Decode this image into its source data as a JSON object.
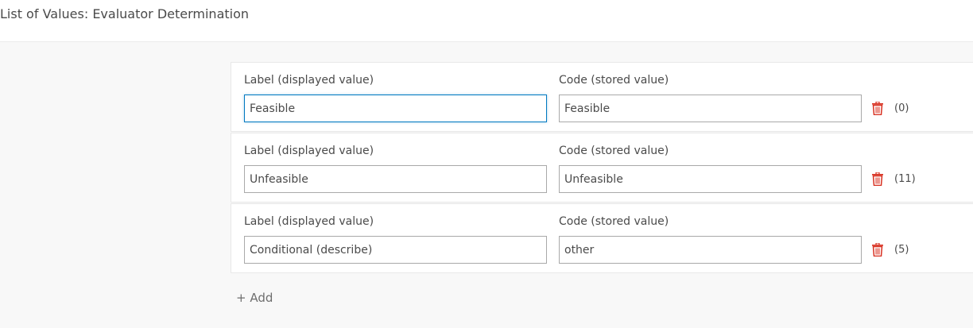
{
  "title": "List of Values: Evaluator Determination",
  "label_header": "Label (displayed value)",
  "code_header": "Code (stored value)",
  "rows": [
    {
      "label": "Feasible",
      "code": "Feasible",
      "count": "(0)"
    },
    {
      "label": "Unfeasible",
      "code": "Unfeasible",
      "count": "(11)"
    },
    {
      "label": "Conditional (describe)",
      "code": "other",
      "count": "(5)"
    }
  ],
  "add_label": "+ Add",
  "colors": {
    "accent": "#0079c1",
    "delete": "#d83020"
  }
}
